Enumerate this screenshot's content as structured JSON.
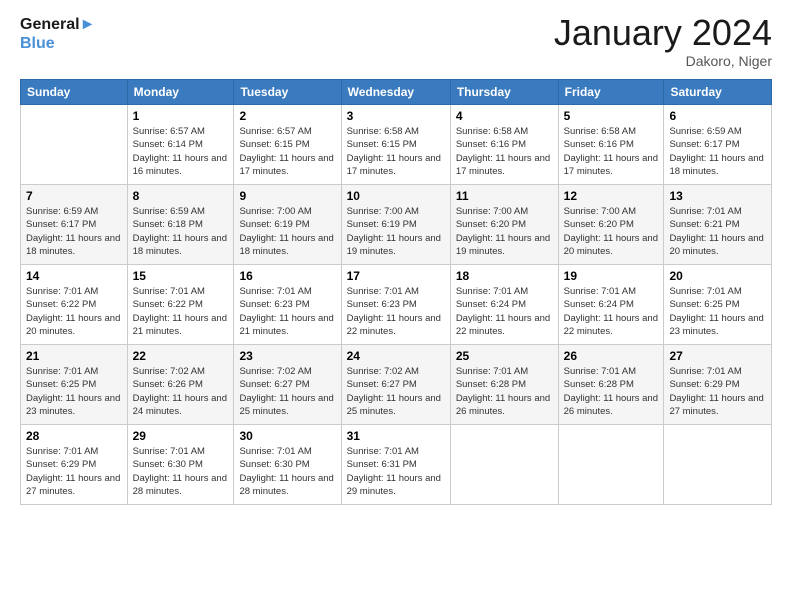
{
  "header": {
    "logo_line1": "General",
    "logo_line2": "Blue",
    "month": "January 2024",
    "location": "Dakoro, Niger"
  },
  "days_of_week": [
    "Sunday",
    "Monday",
    "Tuesday",
    "Wednesday",
    "Thursday",
    "Friday",
    "Saturday"
  ],
  "weeks": [
    [
      {
        "day": "",
        "sunrise": "",
        "sunset": "",
        "daylight": ""
      },
      {
        "day": "1",
        "sunrise": "Sunrise: 6:57 AM",
        "sunset": "Sunset: 6:14 PM",
        "daylight": "Daylight: 11 hours and 16 minutes."
      },
      {
        "day": "2",
        "sunrise": "Sunrise: 6:57 AM",
        "sunset": "Sunset: 6:15 PM",
        "daylight": "Daylight: 11 hours and 17 minutes."
      },
      {
        "day": "3",
        "sunrise": "Sunrise: 6:58 AM",
        "sunset": "Sunset: 6:15 PM",
        "daylight": "Daylight: 11 hours and 17 minutes."
      },
      {
        "day": "4",
        "sunrise": "Sunrise: 6:58 AM",
        "sunset": "Sunset: 6:16 PM",
        "daylight": "Daylight: 11 hours and 17 minutes."
      },
      {
        "day": "5",
        "sunrise": "Sunrise: 6:58 AM",
        "sunset": "Sunset: 6:16 PM",
        "daylight": "Daylight: 11 hours and 17 minutes."
      },
      {
        "day": "6",
        "sunrise": "Sunrise: 6:59 AM",
        "sunset": "Sunset: 6:17 PM",
        "daylight": "Daylight: 11 hours and 18 minutes."
      }
    ],
    [
      {
        "day": "7",
        "sunrise": "Sunrise: 6:59 AM",
        "sunset": "Sunset: 6:17 PM",
        "daylight": "Daylight: 11 hours and 18 minutes."
      },
      {
        "day": "8",
        "sunrise": "Sunrise: 6:59 AM",
        "sunset": "Sunset: 6:18 PM",
        "daylight": "Daylight: 11 hours and 18 minutes."
      },
      {
        "day": "9",
        "sunrise": "Sunrise: 7:00 AM",
        "sunset": "Sunset: 6:19 PM",
        "daylight": "Daylight: 11 hours and 18 minutes."
      },
      {
        "day": "10",
        "sunrise": "Sunrise: 7:00 AM",
        "sunset": "Sunset: 6:19 PM",
        "daylight": "Daylight: 11 hours and 19 minutes."
      },
      {
        "day": "11",
        "sunrise": "Sunrise: 7:00 AM",
        "sunset": "Sunset: 6:20 PM",
        "daylight": "Daylight: 11 hours and 19 minutes."
      },
      {
        "day": "12",
        "sunrise": "Sunrise: 7:00 AM",
        "sunset": "Sunset: 6:20 PM",
        "daylight": "Daylight: 11 hours and 20 minutes."
      },
      {
        "day": "13",
        "sunrise": "Sunrise: 7:01 AM",
        "sunset": "Sunset: 6:21 PM",
        "daylight": "Daylight: 11 hours and 20 minutes."
      }
    ],
    [
      {
        "day": "14",
        "sunrise": "Sunrise: 7:01 AM",
        "sunset": "Sunset: 6:22 PM",
        "daylight": "Daylight: 11 hours and 20 minutes."
      },
      {
        "day": "15",
        "sunrise": "Sunrise: 7:01 AM",
        "sunset": "Sunset: 6:22 PM",
        "daylight": "Daylight: 11 hours and 21 minutes."
      },
      {
        "day": "16",
        "sunrise": "Sunrise: 7:01 AM",
        "sunset": "Sunset: 6:23 PM",
        "daylight": "Daylight: 11 hours and 21 minutes."
      },
      {
        "day": "17",
        "sunrise": "Sunrise: 7:01 AM",
        "sunset": "Sunset: 6:23 PM",
        "daylight": "Daylight: 11 hours and 22 minutes."
      },
      {
        "day": "18",
        "sunrise": "Sunrise: 7:01 AM",
        "sunset": "Sunset: 6:24 PM",
        "daylight": "Daylight: 11 hours and 22 minutes."
      },
      {
        "day": "19",
        "sunrise": "Sunrise: 7:01 AM",
        "sunset": "Sunset: 6:24 PM",
        "daylight": "Daylight: 11 hours and 22 minutes."
      },
      {
        "day": "20",
        "sunrise": "Sunrise: 7:01 AM",
        "sunset": "Sunset: 6:25 PM",
        "daylight": "Daylight: 11 hours and 23 minutes."
      }
    ],
    [
      {
        "day": "21",
        "sunrise": "Sunrise: 7:01 AM",
        "sunset": "Sunset: 6:25 PM",
        "daylight": "Daylight: 11 hours and 23 minutes."
      },
      {
        "day": "22",
        "sunrise": "Sunrise: 7:02 AM",
        "sunset": "Sunset: 6:26 PM",
        "daylight": "Daylight: 11 hours and 24 minutes."
      },
      {
        "day": "23",
        "sunrise": "Sunrise: 7:02 AM",
        "sunset": "Sunset: 6:27 PM",
        "daylight": "Daylight: 11 hours and 25 minutes."
      },
      {
        "day": "24",
        "sunrise": "Sunrise: 7:02 AM",
        "sunset": "Sunset: 6:27 PM",
        "daylight": "Daylight: 11 hours and 25 minutes."
      },
      {
        "day": "25",
        "sunrise": "Sunrise: 7:01 AM",
        "sunset": "Sunset: 6:28 PM",
        "daylight": "Daylight: 11 hours and 26 minutes."
      },
      {
        "day": "26",
        "sunrise": "Sunrise: 7:01 AM",
        "sunset": "Sunset: 6:28 PM",
        "daylight": "Daylight: 11 hours and 26 minutes."
      },
      {
        "day": "27",
        "sunrise": "Sunrise: 7:01 AM",
        "sunset": "Sunset: 6:29 PM",
        "daylight": "Daylight: 11 hours and 27 minutes."
      }
    ],
    [
      {
        "day": "28",
        "sunrise": "Sunrise: 7:01 AM",
        "sunset": "Sunset: 6:29 PM",
        "daylight": "Daylight: 11 hours and 27 minutes."
      },
      {
        "day": "29",
        "sunrise": "Sunrise: 7:01 AM",
        "sunset": "Sunset: 6:30 PM",
        "daylight": "Daylight: 11 hours and 28 minutes."
      },
      {
        "day": "30",
        "sunrise": "Sunrise: 7:01 AM",
        "sunset": "Sunset: 6:30 PM",
        "daylight": "Daylight: 11 hours and 28 minutes."
      },
      {
        "day": "31",
        "sunrise": "Sunrise: 7:01 AM",
        "sunset": "Sunset: 6:31 PM",
        "daylight": "Daylight: 11 hours and 29 minutes."
      },
      {
        "day": "",
        "sunrise": "",
        "sunset": "",
        "daylight": ""
      },
      {
        "day": "",
        "sunrise": "",
        "sunset": "",
        "daylight": ""
      },
      {
        "day": "",
        "sunrise": "",
        "sunset": "",
        "daylight": ""
      }
    ]
  ]
}
